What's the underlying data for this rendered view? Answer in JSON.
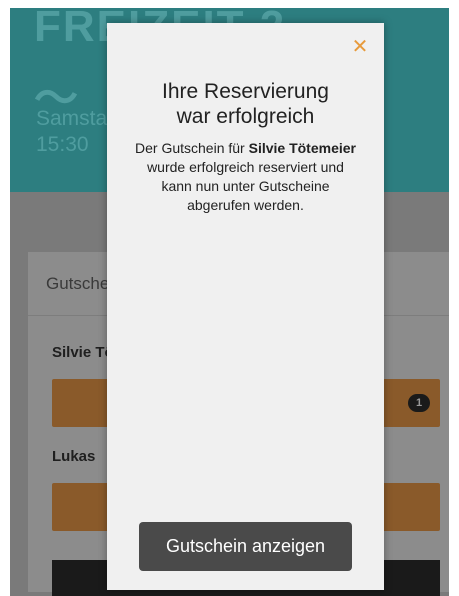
{
  "background": {
    "hero_title": "FREIZEIT 2",
    "hero_wave": "〜",
    "hero_date_line1": "Samstag",
    "hero_date_line2": "15:30",
    "card_header": "Gutscheine",
    "persons": [
      {
        "name": "Silvie Tötemeier",
        "badge_count": "1"
      },
      {
        "name": "Lukas"
      }
    ]
  },
  "modal": {
    "close_icon": "close-icon",
    "title_line1": "Ihre Reservierung",
    "title_line2": "war erfolgreich",
    "message_prefix": "Der Gutschein für ",
    "message_name": "Silvie Tötemeier",
    "message_suffix": " wurde erfolgreich reserviert und kann nun unter Gutscheine abgerufen werden.",
    "button_label": "Gutschein anzeigen",
    "accent_color": "#e79a3b"
  }
}
